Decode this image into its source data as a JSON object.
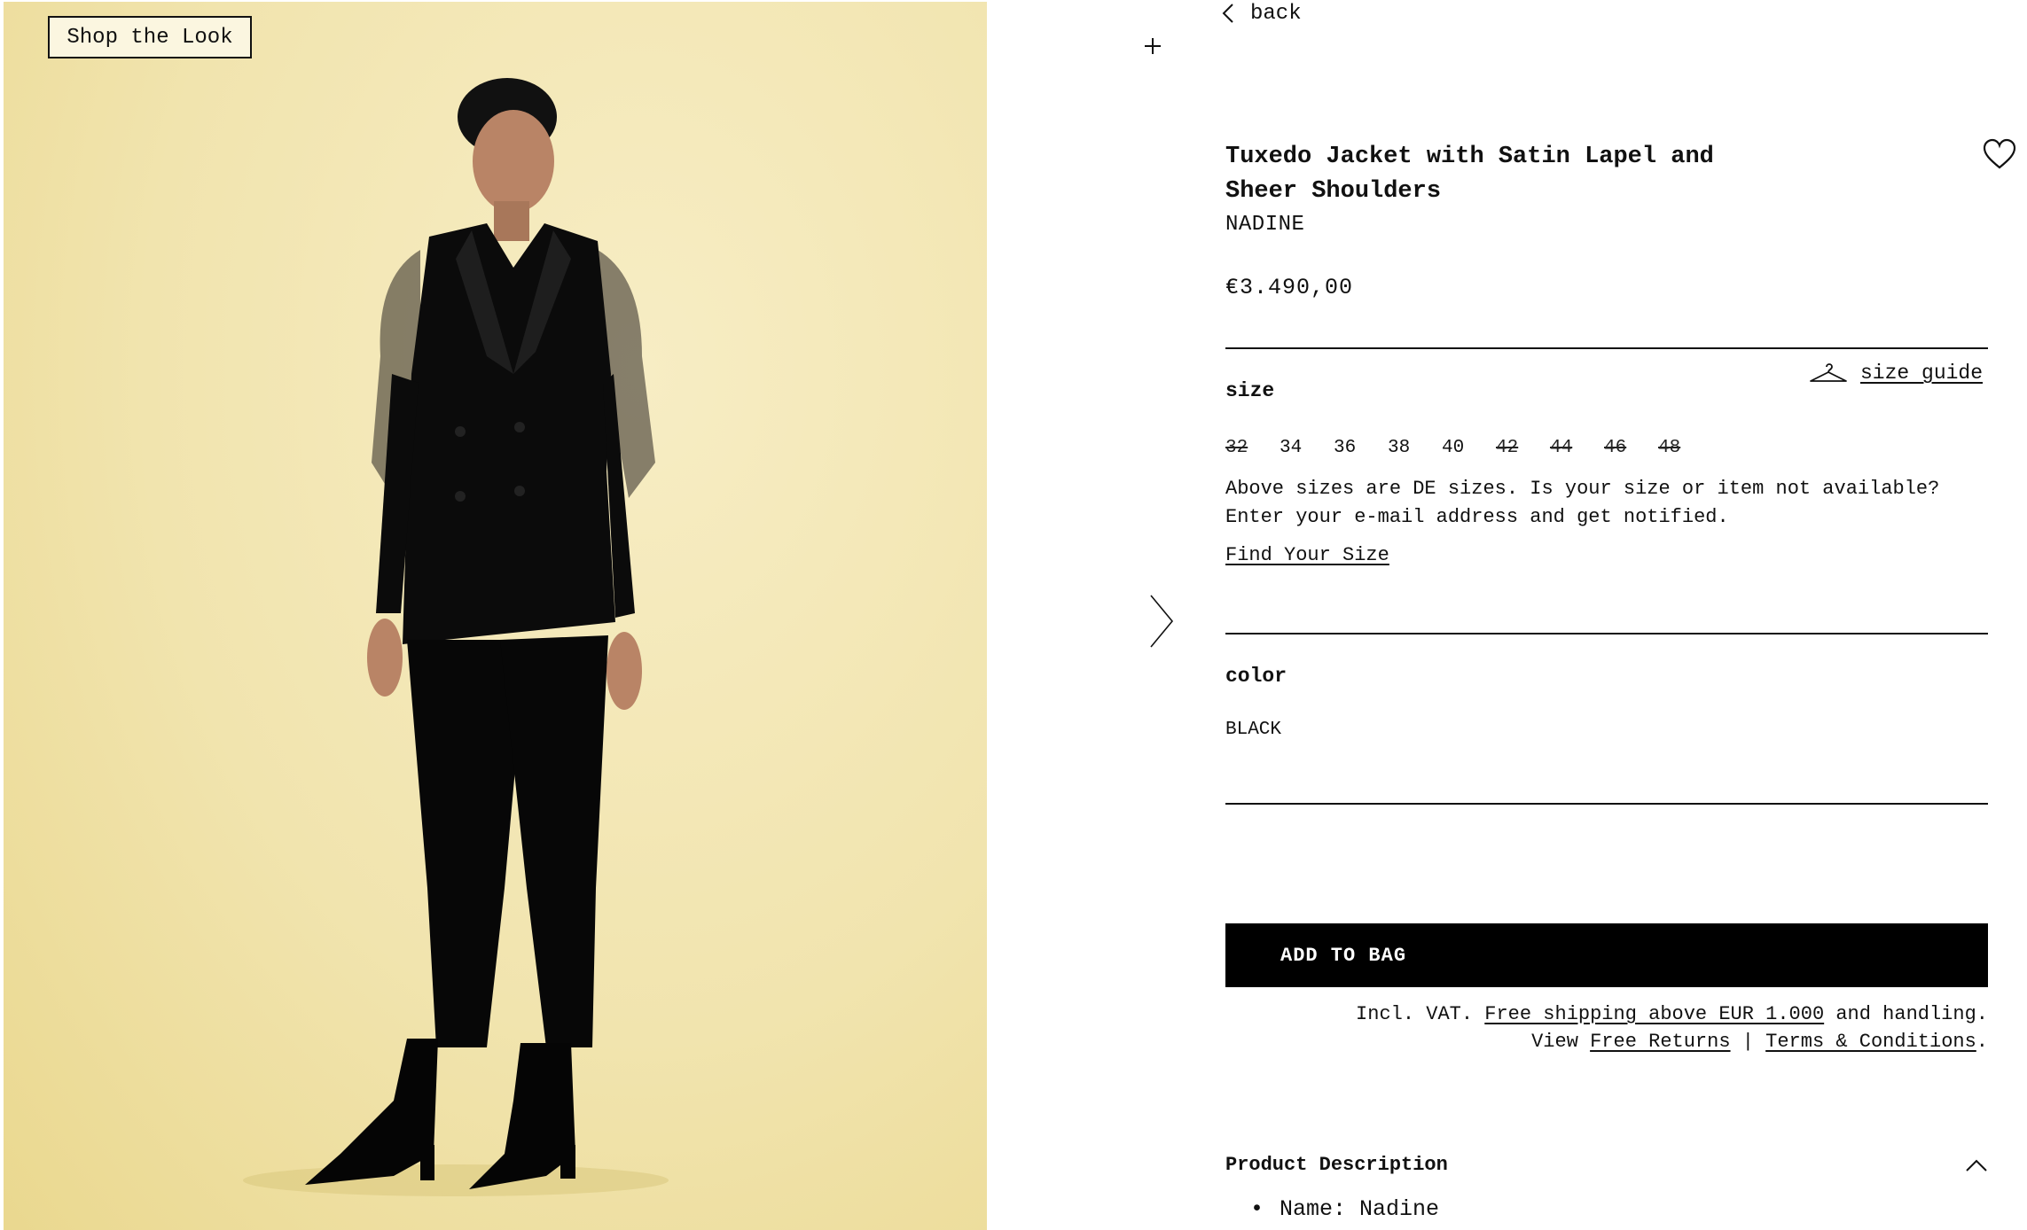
{
  "image_panel": {
    "shop_the_look_label": "Shop the Look"
  },
  "nav": {
    "back_label": "back"
  },
  "product": {
    "title": "Tuxedo Jacket with Satin Lapel and Sheer Shoulders",
    "brand": "NADINE",
    "price": "€3.490,00"
  },
  "size_section": {
    "label": "size",
    "size_guide_label": "size guide",
    "sizes": [
      {
        "label": "32",
        "available": false
      },
      {
        "label": "34",
        "available": true
      },
      {
        "label": "36",
        "available": true
      },
      {
        "label": "38",
        "available": true
      },
      {
        "label": "40",
        "available": true
      },
      {
        "label": "42",
        "available": false
      },
      {
        "label": "44",
        "available": false
      },
      {
        "label": "46",
        "available": false
      },
      {
        "label": "48",
        "available": false
      }
    ],
    "note": "Above sizes are DE sizes. Is your size or item not available? Enter your e-mail address and get notified.",
    "find_your_size_label": "Find Your Size"
  },
  "color_section": {
    "label": "color",
    "value": "BLACK"
  },
  "cart": {
    "add_to_bag_label": "ADD TO BAG",
    "vat_prefix": "Incl. VAT. ",
    "free_shipping_link": "Free shipping above EUR 1.000",
    "handling_suffix": " and handling.",
    "view_prefix": "View ",
    "free_returns_link": "Free Returns",
    "separator": " | ",
    "terms_link": "Terms & Conditions",
    "terms_suffix": "."
  },
  "description": {
    "header": "Product Description",
    "items": [
      "Name: Nadine"
    ]
  },
  "icons": {
    "heart": "heart-icon",
    "hanger": "hanger-icon",
    "plus": "plus-icon",
    "chevron_left": "chevron-left-icon",
    "chevron_right": "chevron-right-icon",
    "chevron_up": "chevron-up-icon"
  }
}
